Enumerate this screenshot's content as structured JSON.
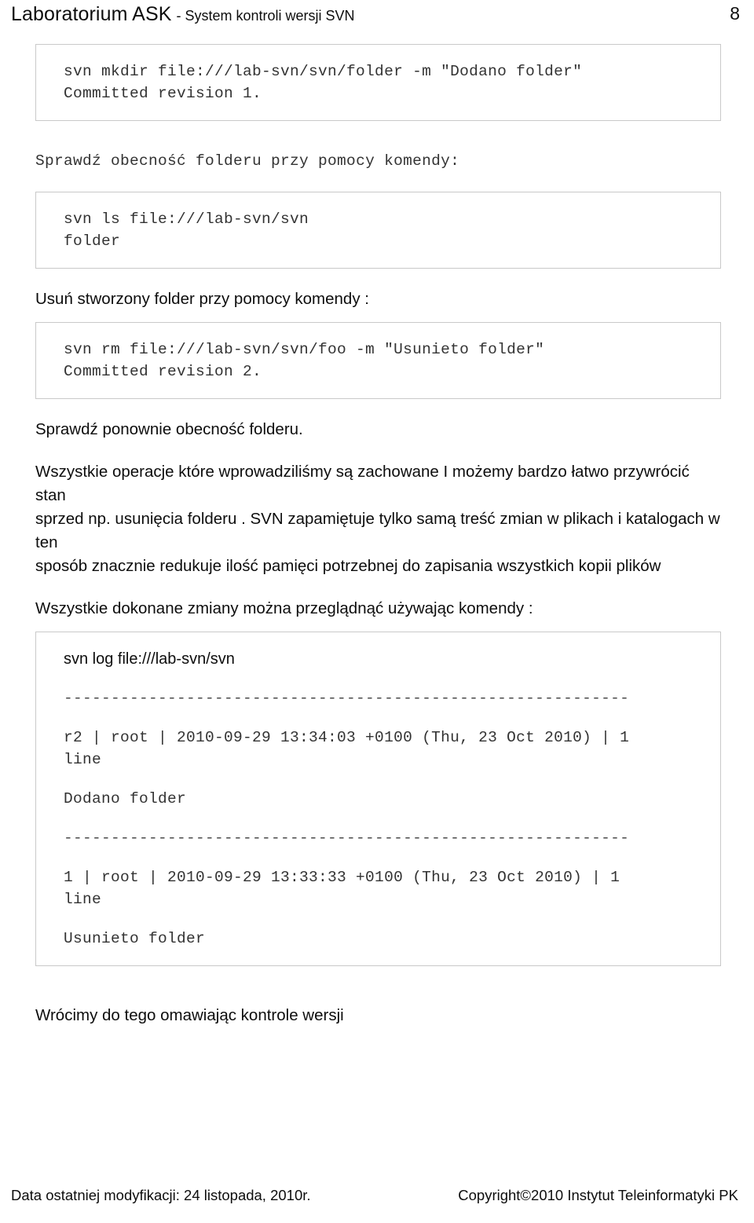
{
  "header": {
    "title": "Laboratorium ASK",
    "subtitle": "- System kontroli wersji SVN",
    "page_number": "8"
  },
  "blocks": {
    "code1": {
      "line1": "svn mkdir file:///lab-svn/svn/folder -m \"Dodano folder\"",
      "line2": "Committed revision 1."
    },
    "para1": "Sprawdź obecność folderu przy pomocy komendy:",
    "code2": {
      "line1": "svn ls file:///lab-svn/svn",
      "line2": "folder"
    },
    "para2": "Usuń  stworzony folder przy pomocy komendy :",
    "code3": {
      "line1": "svn rm file:///lab-svn/svn/foo -m \"Usunieto folder\"",
      "line2": "Committed revision 2."
    },
    "para3": "Sprawdź ponownie obecność folderu.",
    "para4_line1": "Wszystkie operacje które wprowadziliśmy  są zachowane I możemy bardzo łatwo przywrócić stan",
    "para4_line2": "sprzed np. usunięcia folderu . SVN zapamiętuje tylko samą treść zmian w plikach i katalogach w ten",
    "para4_line3": "sposób znacznie redukuje ilość pamięci potrzebnej do zapisania wszystkich kopii plików",
    "para5": "Wszystkie dokonane zmiany  można przeglądnąć używając komendy :",
    "logbox": {
      "command": "svn log file:///lab-svn/svn",
      "rule1": "------------------------------------------------------------",
      "entry1_line1": "r2 | root | 2010-09-29 13:34:03 +0100 (Thu, 23 Oct 2010) | 1",
      "entry1_line2": "line",
      "entry1_message": "Dodano folder",
      "rule2": "------------------------------------------------------------",
      "entry2_line1": "1 | root | 2010-09-29 13:33:33 +0100 (Thu, 23 Oct 2010) | 1",
      "entry2_line2": "line",
      "entry2_message": "Usunieto folder"
    },
    "para6": "Wrócimy do tego omawiając kontrole wersji"
  },
  "footer": {
    "left": "Data ostatniej modyfikacji: 24 listopada, 2010r.",
    "right": "Copyright©2010 Instytut Teleinformatyki PK"
  }
}
